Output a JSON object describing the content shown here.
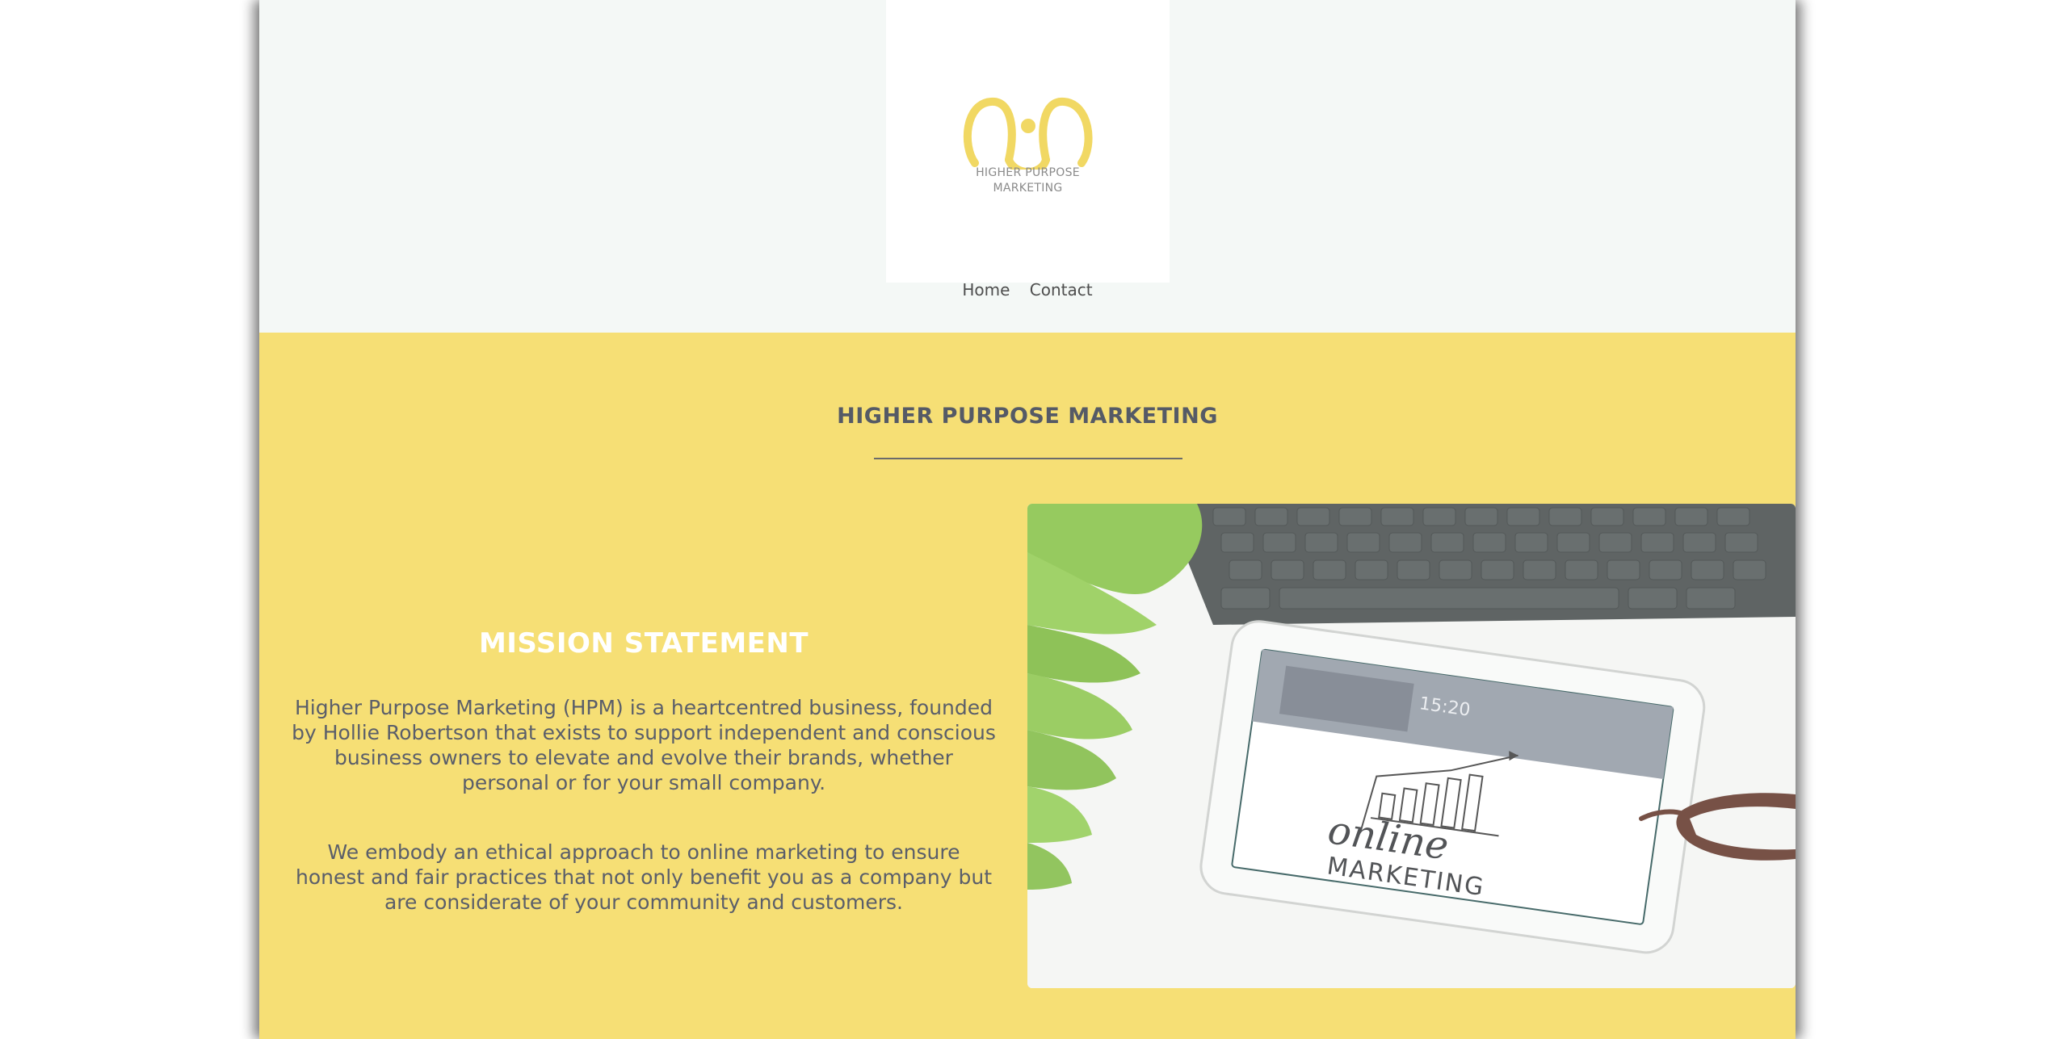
{
  "brand": {
    "logo_lines": [
      "HIGHER PURPOSE",
      "MARKETING"
    ],
    "logo_icon": "hpm-logo-mark",
    "accent_color": "#f6df75",
    "text_color": "#555a66"
  },
  "nav": {
    "items": [
      {
        "label": "Home"
      },
      {
        "label": "Contact"
      }
    ]
  },
  "main": {
    "section_title": "HIGHER PURPOSE MARKETING",
    "mission": {
      "heading": "MISSION STATEMENT",
      "paragraphs": [
        "Higher Purpose Marketing (HPM) is a heartcentred business, founded by Hollie Robertson that exists to support independent and conscious business owners to elevate and evolve their brands, whether personal or for your small company.",
        "We embody an ethical approach to online marketing to ensure honest and fair practices that not only benefit you as a company but are considerate of your community and customers."
      ]
    },
    "image": {
      "tablet_clock": "15:20",
      "tablet_caption_top": "online",
      "tablet_caption_bottom": "MARKETING"
    }
  }
}
